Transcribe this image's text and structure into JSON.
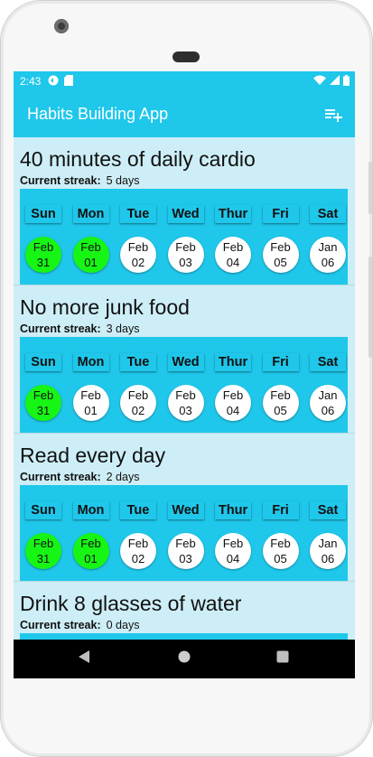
{
  "status": {
    "time": "2:43"
  },
  "app": {
    "title": "Habits Building App"
  },
  "streak_label": "Current streak:",
  "habits": [
    {
      "name": "40 minutes of daily cardio",
      "streak": "5 days",
      "days": [
        {
          "label": "Sun",
          "month": "Feb",
          "day": "31",
          "done": true
        },
        {
          "label": "Mon",
          "month": "Feb",
          "day": "01",
          "done": true
        },
        {
          "label": "Tue",
          "month": "Feb",
          "day": "02",
          "done": false
        },
        {
          "label": "Wed",
          "month": "Feb",
          "day": "03",
          "done": false
        },
        {
          "label": "Thur",
          "month": "Feb",
          "day": "04",
          "done": false
        },
        {
          "label": "Fri",
          "month": "Feb",
          "day": "05",
          "done": false
        },
        {
          "label": "Sat",
          "month": "Jan",
          "day": "06",
          "done": false
        }
      ]
    },
    {
      "name": "No more junk food",
      "streak": "3 days",
      "days": [
        {
          "label": "Sun",
          "month": "Feb",
          "day": "31",
          "done": true
        },
        {
          "label": "Mon",
          "month": "Feb",
          "day": "01",
          "done": false
        },
        {
          "label": "Tue",
          "month": "Feb",
          "day": "02",
          "done": false
        },
        {
          "label": "Wed",
          "month": "Feb",
          "day": "03",
          "done": false
        },
        {
          "label": "Thur",
          "month": "Feb",
          "day": "04",
          "done": false
        },
        {
          "label": "Fri",
          "month": "Feb",
          "day": "05",
          "done": false
        },
        {
          "label": "Sat",
          "month": "Jan",
          "day": "06",
          "done": false
        }
      ]
    },
    {
      "name": "Read every day",
      "streak": "2 days",
      "days": [
        {
          "label": "Sun",
          "month": "Feb",
          "day": "31",
          "done": true
        },
        {
          "label": "Mon",
          "month": "Feb",
          "day": "01",
          "done": true
        },
        {
          "label": "Tue",
          "month": "Feb",
          "day": "02",
          "done": false
        },
        {
          "label": "Wed",
          "month": "Feb",
          "day": "03",
          "done": false
        },
        {
          "label": "Thur",
          "month": "Feb",
          "day": "04",
          "done": false
        },
        {
          "label": "Fri",
          "month": "Feb",
          "day": "05",
          "done": false
        },
        {
          "label": "Sat",
          "month": "Jan",
          "day": "06",
          "done": false
        }
      ]
    },
    {
      "name": "Drink 8 glasses of water",
      "streak": "0 days",
      "days": []
    }
  ],
  "colors": {
    "primary": "#1fc7ea",
    "done": "#17f515",
    "background": "#cdeef7"
  },
  "icons": {
    "add": "playlist-add-icon",
    "back": "back-icon",
    "home": "home-icon",
    "recents": "recents-icon"
  }
}
